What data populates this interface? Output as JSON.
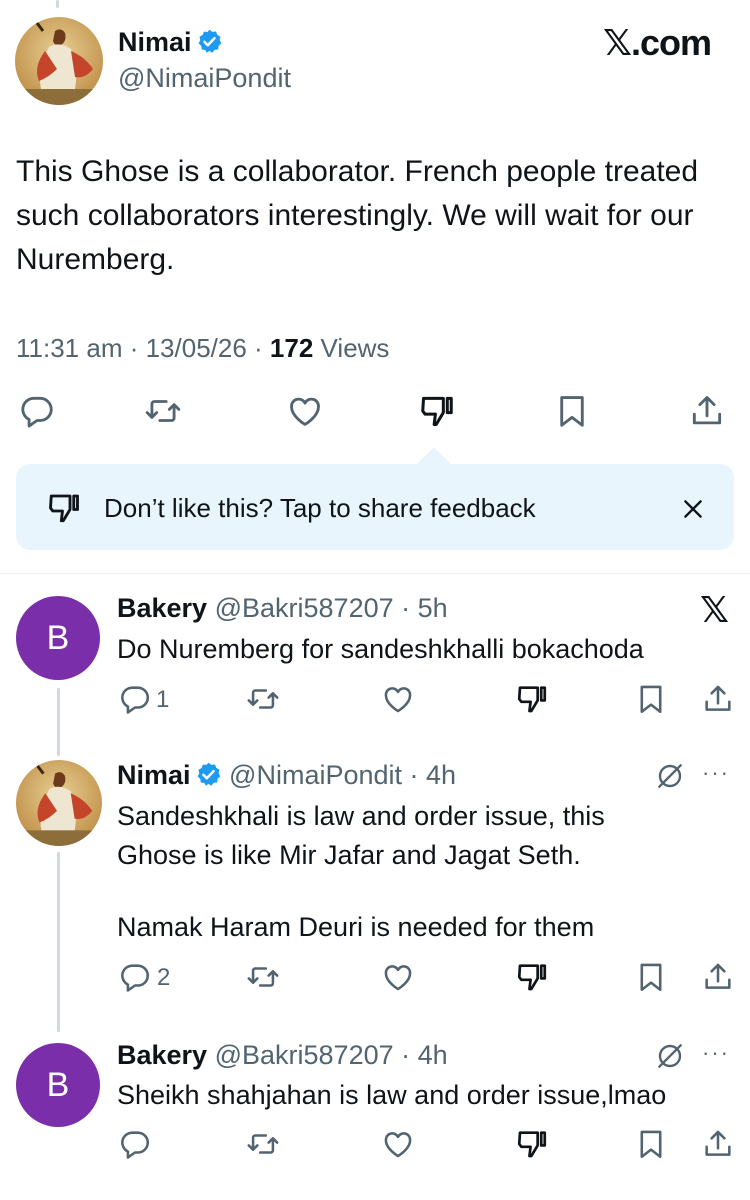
{
  "main_tweet": {
    "author_name": "Nimai",
    "author_handle": "@NimaiPondit",
    "site_logo": ".com",
    "text": "This Ghose is a collaborator. French people treated such collaborators interestingly. We will wait for our Nuremberg.",
    "time": "11:31 am",
    "date": "13/05/26",
    "views_count": "172",
    "views_label": "Views"
  },
  "feedback_banner": {
    "text": "Don’t like this? Tap to share feedback"
  },
  "replies": [
    {
      "author_name": "Bakery",
      "author_handle": "@Bakri587207",
      "time": "5h",
      "avatar_letter": "B",
      "text": "Do Nuremberg for sandeshkhalli bokachoda",
      "reply_count": "1"
    },
    {
      "author_name": "Nimai",
      "author_handle": "@NimaiPondit",
      "time": "4h",
      "text_line1": "Sandeshkhali is law and order issue, this",
      "text_line2": "Ghose is like Mir Jafar and Jagat Seth.",
      "text_line3": "Namak Haram Deuri is needed for them",
      "reply_count": "2"
    },
    {
      "author_name": "Bakery",
      "author_handle": "@Bakri587207",
      "time": "4h",
      "avatar_letter": "B",
      "text": "Sheikh shahjahan is law and order issue,lmao"
    }
  ],
  "colors": {
    "verified": "#1d9bf0",
    "avatar_purple": "#7a2eaa",
    "banner_bg": "#e8f5fd",
    "secondary_text": "#536471"
  }
}
